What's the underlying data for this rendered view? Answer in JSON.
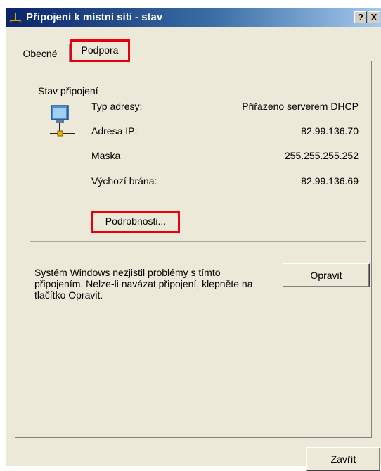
{
  "window": {
    "title": "Připojení k místní síti - stav",
    "help_label": "?",
    "close_label": "X"
  },
  "tabs": [
    {
      "label": "Obecné",
      "active": false
    },
    {
      "label": "Podpora",
      "active": true
    }
  ],
  "group": {
    "legend": "Stav připojení",
    "rows": [
      {
        "label": "Typ adresy:",
        "value": "Přiřazeno serverem DHCP"
      },
      {
        "label": "Adresa IP:",
        "value": "82.99.136.70"
      },
      {
        "label": "Maska",
        "value": "255.255.255.252"
      },
      {
        "label": "Výchozí brána:",
        "value": "82.99.136.69"
      }
    ],
    "details_button": "Podrobnosti..."
  },
  "repair": {
    "message": "Systém Windows nezjistil problémy s tímto připojením. Nelze-li navázat připojení, klepněte na tlačítko Opravit.",
    "button": "Opravit"
  },
  "footer": {
    "close_button": "Zavřít"
  },
  "colors": {
    "highlight": "#e8000e",
    "dialog_bg": "#ece9d8",
    "titlebar": "#0a246a"
  }
}
